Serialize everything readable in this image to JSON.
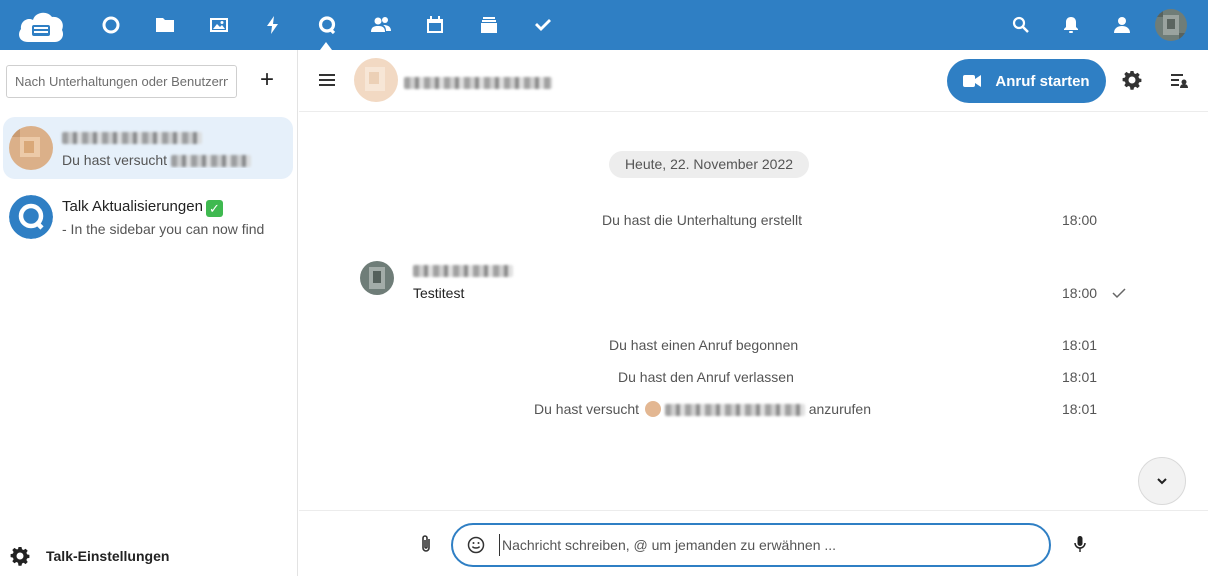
{
  "topbar": {
    "brand_color": "#2f7fc4",
    "nav_icons": [
      "dashboard-icon",
      "files-icon",
      "photos-icon",
      "activity-icon",
      "talk-icon",
      "contacts-icon",
      "calendar-icon",
      "deck-icon",
      "tasks-icon"
    ],
    "right_icons": [
      "search-icon",
      "notifications-icon",
      "contacts-menu-icon",
      "user-avatar"
    ]
  },
  "sidebar": {
    "search_placeholder": "Nach Unterhaltungen oder Benutzern suchen",
    "new_conversation_label": "+",
    "conversations": [
      {
        "name": "",
        "subtitle": "Du hast versucht",
        "active": true
      },
      {
        "name": "Talk Aktualisierungen",
        "subtitle": "- In the sidebar you can now find",
        "active": false
      }
    ],
    "settings_label": "Talk-Einstellungen"
  },
  "chat_header": {
    "call_button_label": "Anruf starten"
  },
  "messages": {
    "date_separator": "Heute, 22. November 2022",
    "items": [
      {
        "type": "system",
        "text": "Du hast die Unterhaltung erstellt",
        "time": "18:00"
      },
      {
        "type": "message",
        "text": "Testitest",
        "time": "18:00"
      },
      {
        "type": "system",
        "text": "Du hast einen Anruf begonnen",
        "time": "18:01"
      },
      {
        "type": "system",
        "text": "Du hast den Anruf verlassen",
        "time": "18:01"
      },
      {
        "type": "system",
        "text_before": "Du hast versucht",
        "text_after": "anzurufen",
        "time": "18:01"
      }
    ]
  },
  "composer": {
    "placeholder": "Nachricht schreiben, @ um jemanden zu erwähnen ..."
  }
}
